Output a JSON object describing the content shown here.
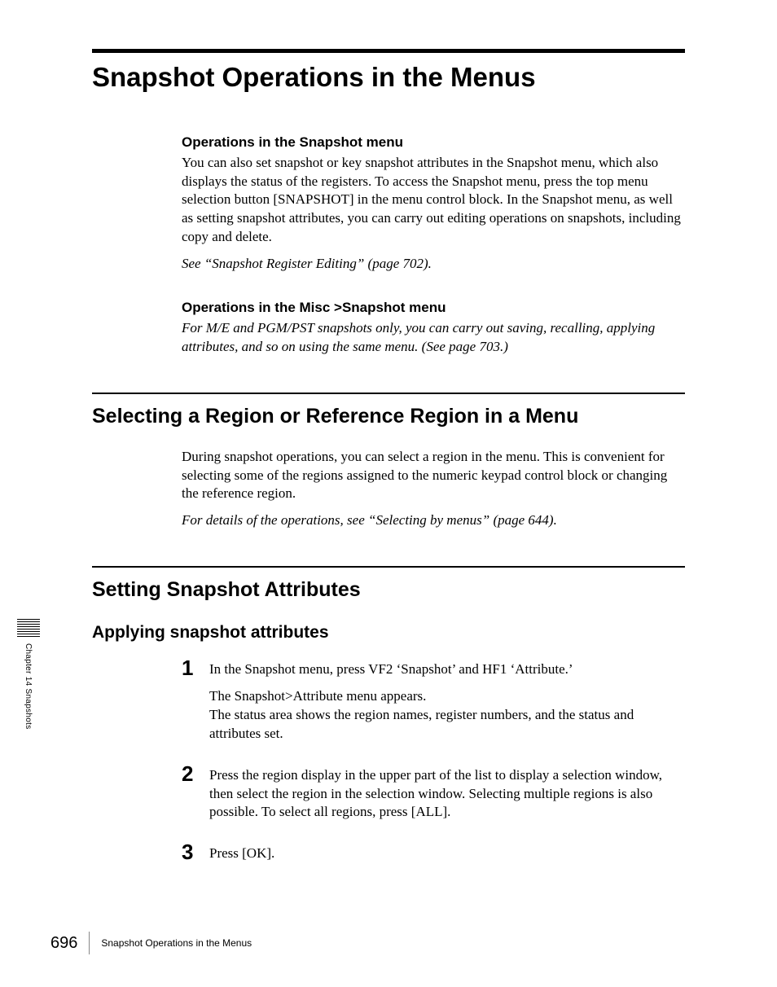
{
  "chapter_title": "Snapshot Operations in the Menus",
  "operations_snapshot": {
    "heading": "Operations in the Snapshot menu",
    "body": "You can also set snapshot or key snapshot attributes in the Snapshot menu, which also displays the status of the registers. To access the Snapshot menu, press the top menu selection button [SNAPSHOT] in the menu control block. In the Snapshot menu, as well as setting snapshot attributes, you can carry out editing operations on snapshots, including copy and delete.",
    "see": "See “Snapshot Register Editing” (page 702)."
  },
  "operations_misc": {
    "heading": "Operations in the Misc >Snapshot menu",
    "body": "For M/E and PGM/PST snapshots only, you can carry out saving, recalling, applying attributes, and so on using the same menu. (See page 703.)"
  },
  "section1": {
    "heading": "Selecting a Region or Reference Region in a Menu",
    "body": "During snapshot operations, you can select a region in the menu. This is convenient for selecting some of the regions assigned to the numeric keypad control block or changing the reference region.",
    "see": "For details of the operations, see “Selecting by menus” (page 644)."
  },
  "section2": {
    "heading": "Setting Snapshot Attributes",
    "subheading": "Applying snapshot attributes",
    "steps": [
      {
        "num": "1",
        "p1": "In the Snapshot menu, press VF2 ‘Snapshot’ and HF1 ‘Attribute.’",
        "p2": "The Snapshot>Attribute menu appears.",
        "p3": "The status area shows the region names, register numbers, and the status and attributes set."
      },
      {
        "num": "2",
        "p1": "Press the region display in the upper part of the list to display a selection window, then select the region in the selection window. Selecting multiple regions is also possible. To select all regions, press [ALL]."
      },
      {
        "num": "3",
        "p1": "Press [OK]."
      }
    ]
  },
  "side_tab": "Chapter 14  Snapshots",
  "footer": {
    "page": "696",
    "title": "Snapshot Operations in the Menus"
  }
}
